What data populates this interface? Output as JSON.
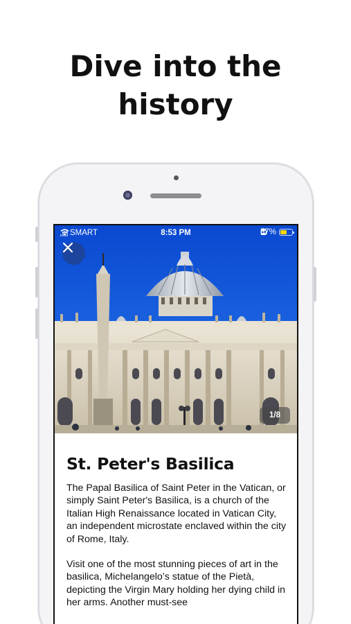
{
  "headline": {
    "line1": "Dive into the",
    "line2": "history"
  },
  "status_bar": {
    "carrier": "SMART",
    "time": "8:53 PM",
    "battery": "57%",
    "battery_level": 0.57
  },
  "gallery": {
    "counter": "1/8"
  },
  "place": {
    "title": "St. Peter's Basilica",
    "paragraphs": [
      "The Papal Basilica of Saint Peter in the Vatican, or simply Saint Peter's Basilica, is a church of the Italian High Renaissance located in Vatican City, an independent microstate enclaved within the city of Rome, Italy.",
      "Visit one of the most stunning pieces of art in the basilica, Michelangelo’s statue of the Pietà, depicting the Virgin Mary holding her dying child in her arms. Another must-see"
    ]
  },
  "icons": {
    "close": "close-icon",
    "wifi": "wifi-icon",
    "signal": "signal-icon",
    "alarm": "alarm-icon",
    "orientation": "person-icon",
    "battery": "battery-icon"
  },
  "colors": {
    "sky": "#0a4fd6",
    "battery": "#ffd60a",
    "text": "#111111"
  }
}
